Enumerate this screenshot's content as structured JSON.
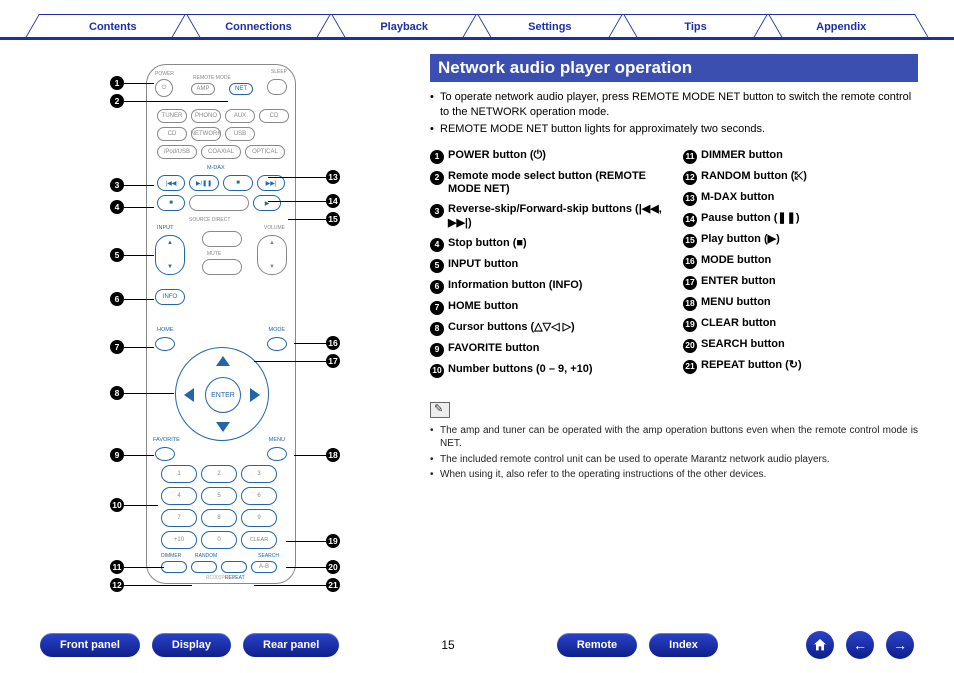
{
  "tabs": [
    "Contents",
    "Connections",
    "Playback",
    "Settings",
    "Tips",
    "Appendix"
  ],
  "section_title": "Network audio player operation",
  "intro": [
    "To operate network audio player, press REMOTE MODE NET button to switch the remote control to the NETWORK operation mode.",
    "REMOTE MODE NET button lights for approximately two seconds."
  ],
  "items_left": [
    "POWER button (⏻)",
    "Remote mode select button (REMOTE MODE NET)",
    "Reverse-skip/Forward-skip buttons (|◀◀, ▶▶|)",
    "Stop button (■)",
    "INPUT button",
    "Information button (INFO)",
    "HOME button",
    "Cursor buttons (△▽◁ ▷)",
    "FAVORITE button",
    "Number buttons (0 – 9, +10)"
  ],
  "items_right": [
    "DIMMER button",
    "RANDOM button (⤪)",
    "M-DAX button",
    "Pause button (❚❚)",
    "Play button (▶)",
    "MODE button",
    "ENTER button",
    "MENU button",
    "CLEAR button",
    "SEARCH button",
    "REPEAT button (↻)"
  ],
  "notes": [
    "The amp and tuner can be operated with the amp operation buttons even when the remote control mode is NET.",
    "The included remote control unit can be used to operate Marantz network audio players.",
    "When using it, also refer to the operating instructions of the other devices."
  ],
  "bottom_links": [
    "Front panel",
    "Display",
    "Rear panel"
  ],
  "bottom_links2": [
    "Remote",
    "Index"
  ],
  "page": "15",
  "remote_model": "RC001PMCD",
  "remote_labels": {
    "mdax": "M-DAX",
    "input": "INPUT",
    "info": "INFO",
    "home": "HOME",
    "mode": "MODE",
    "enter": "ENTER",
    "favorite": "FAVORITE",
    "menu": "MENU",
    "clear": "CLEAR",
    "plus10": "+10",
    "zero": "0",
    "dimmer": "DIMMER",
    "random": "RANDOM",
    "repeat": "REPEAT",
    "search": "SEARCH",
    "power": "POWER",
    "net": "NET",
    "remote_mode": "REMOTE MODE",
    "sleep": "SLEEP",
    "mute": "MUTE",
    "volume": "VOLUME",
    "source": "SOURCE DIRECT"
  }
}
